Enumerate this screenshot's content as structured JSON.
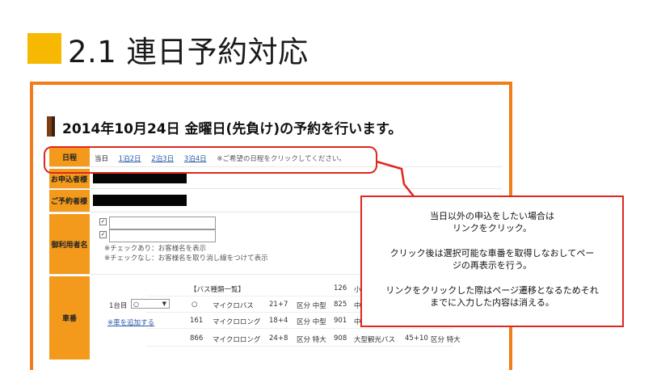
{
  "slide": {
    "title": "2.1 連日予約対応"
  },
  "page": {
    "heading": "2014年10月24日 金曜日(先負け)の予約を行います。"
  },
  "form": {
    "schedule": {
      "label": "日程",
      "current": "当日",
      "links": [
        "1泊2日",
        "2泊3日",
        "3泊4日"
      ],
      "note": "※ご希望の日程をクリックしてください。"
    },
    "applicant": {
      "label": "お申込者様"
    },
    "reservation": {
      "label": "ご予約者様"
    },
    "users": {
      "label": "御利用者名",
      "check1": "✓",
      "check2": "✓",
      "note1": "※チェックあり：お客様名を表示",
      "note2": "※チェックなし：お客様名を取り消し線をつけて表示"
    },
    "vehicle": {
      "label": "車番",
      "day_label": "1台目",
      "select_value": "○",
      "add_link": "※車を追加する",
      "list_header": "【バス種類一覧】",
      "list_header_num": "126",
      "list_header_tail": "小",
      "rows": [
        {
          "c1": "○",
          "c2": "マイクロバス",
          "c3": "21+7",
          "c4": "区分 中型",
          "c5": "825",
          "c6": "中"
        },
        {
          "c1": "161",
          "c2": "マイクロロング",
          "c3": "18+4",
          "c4": "区分 中型",
          "c5": "901",
          "c6": "中"
        },
        {
          "c1": "866",
          "c2": "マイクロロング",
          "c3": "24+8",
          "c4": "区分 特大",
          "c5": "908",
          "c6": "大型観光バス",
          "c7": "45+10",
          "c8": "区分 特大"
        }
      ]
    }
  },
  "callout": {
    "line1": "当日以外の申込をしたい場合は",
    "line2": "リンクをクリック。",
    "line3": "クリック後は選択可能な車番を取得しなおしてペー",
    "line4": "ジの再表示を行う。",
    "line5": "リンクをクリックした際はページ遷移となるためそれ",
    "line6": "までに入力した内容は消える。"
  },
  "colors": {
    "accent_square": "#f6b800",
    "frame_border": "#ef7d1a",
    "label_bg": "#f39a1c",
    "annotation_red": "#e0261e",
    "link_blue": "#2b5ba8"
  }
}
